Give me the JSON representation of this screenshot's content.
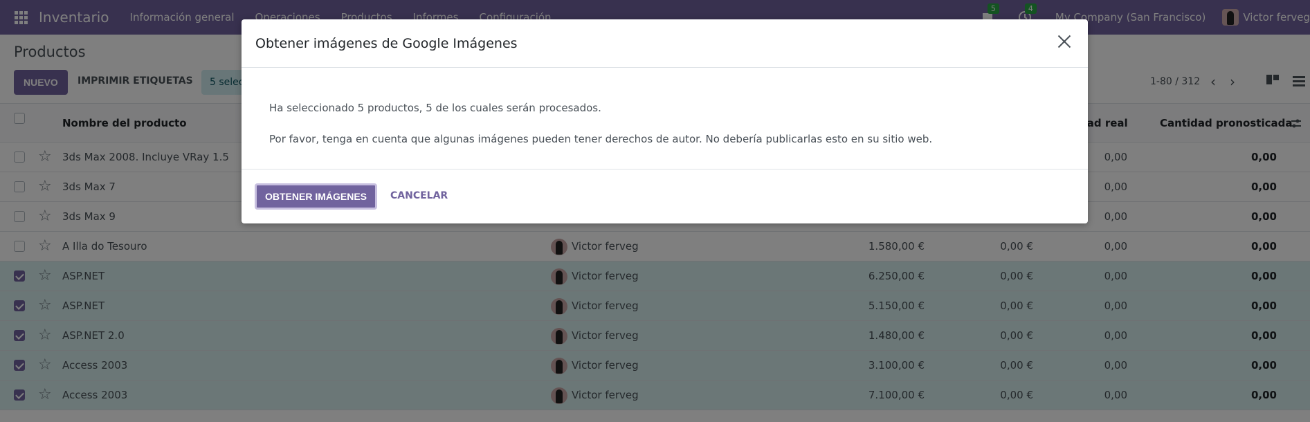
{
  "navbar": {
    "app_name": "Inventario",
    "menu": [
      "Información general",
      "Operaciones",
      "Productos",
      "Informes",
      "Configuración"
    ],
    "messages_badge": "5",
    "activities_badge": "4",
    "company": "My Company (San Francisco)",
    "user": "Victor ferveg"
  },
  "control": {
    "title": "Productos",
    "new_label": "NUEVO",
    "print_label": "IMPRIMIR ETIQUETAS",
    "selected_label": "5 selec",
    "pager": "1-80 / 312"
  },
  "table": {
    "headers": {
      "name": "Nombre del producto",
      "qty_real": "dad real",
      "qty_forecast": "Cantidad pronosticada"
    },
    "rows": [
      {
        "name": "3ds Max 2008. Incluye VRay 1.5",
        "selected": false,
        "user": "",
        "price": "",
        "cost": "",
        "qty": "0,00",
        "forecast": "0,00"
      },
      {
        "name": "3ds Max 7",
        "selected": false,
        "user": "",
        "price": "",
        "cost": "",
        "qty": "0,00",
        "forecast": "0,00"
      },
      {
        "name": "3ds Max 9",
        "selected": false,
        "user": "",
        "price": "",
        "cost": "",
        "qty": "0,00",
        "forecast": "0,00"
      },
      {
        "name": "A Illa do Tesouro",
        "selected": false,
        "user": "Victor ferveg",
        "price": "1.580,00 €",
        "cost": "0,00 €",
        "qty": "0,00",
        "forecast": "0,00"
      },
      {
        "name": "ASP.NET",
        "selected": true,
        "user": "Victor ferveg",
        "price": "6.250,00 €",
        "cost": "0,00 €",
        "qty": "0,00",
        "forecast": "0,00"
      },
      {
        "name": "ASP.NET",
        "selected": true,
        "user": "Victor ferveg",
        "price": "5.150,00 €",
        "cost": "0,00 €",
        "qty": "0,00",
        "forecast": "0,00"
      },
      {
        "name": "ASP.NET 2.0",
        "selected": true,
        "user": "Victor ferveg",
        "price": "1.480,00 €",
        "cost": "0,00 €",
        "qty": "0,00",
        "forecast": "0,00"
      },
      {
        "name": "Access 2003",
        "selected": true,
        "user": "Victor ferveg",
        "price": "3.100,00 €",
        "cost": "0,00 €",
        "qty": "0,00",
        "forecast": "0,00"
      },
      {
        "name": "Access 2003",
        "selected": true,
        "user": "Victor ferveg",
        "price": "7.100,00 €",
        "cost": "0,00 €",
        "qty": "0,00",
        "forecast": "0,00"
      }
    ]
  },
  "modal": {
    "title": "Obtener imágenes de Google Imágenes",
    "line1": "Ha seleccionado 5 productos, 5 de los cuales serán procesados.",
    "line2": "Por favor, tenga en cuenta que algunas imágenes pueden tener derechos de autor. No debería publicarlas esto en su sitio web.",
    "confirm_label": "OBTENER IMÁGENES",
    "cancel_label": "CANCELAR"
  },
  "colors": {
    "brand": "#71639e",
    "selected_row": "#d6efef",
    "badge": "#28a745"
  }
}
